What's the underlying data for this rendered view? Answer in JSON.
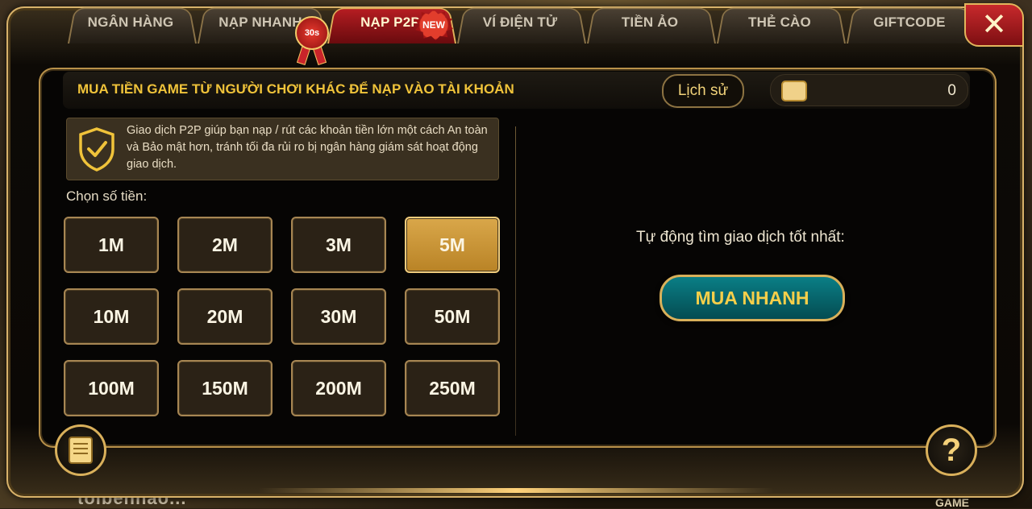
{
  "background": {
    "bottom_text": "toibenhao...",
    "bottom_right_text": "GAME"
  },
  "close_button": {
    "glyph": "✕"
  },
  "tabs": [
    {
      "label": "NGÂN HÀNG",
      "active": false
    },
    {
      "label": "NẠP NHANH",
      "active": false
    },
    {
      "label": "NẠP P2P",
      "active": true
    },
    {
      "label": "VÍ ĐIỆN TỬ",
      "active": false
    },
    {
      "label": "TIỀN ẢO",
      "active": false
    },
    {
      "label": "THẺ CÀO",
      "active": false
    },
    {
      "label": "GIFTCODE",
      "active": false
    }
  ],
  "badges": {
    "nap_nhanh": "30s",
    "nap_p2p": "NEW"
  },
  "header": {
    "title": "MUA TIỀN GAME TỪ NGƯỜI CHƠI KHÁC ĐỂ NẠP VÀO TÀI KHOẢN",
    "history_label": "Lịch sử",
    "wallet_amount": "0"
  },
  "notice": {
    "text": "Giao dịch P2P giúp bạn nạp / rút các khoản tiền lớn một cách An toàn và Bảo mật hơn, tránh tối đa rủi ro bị ngân hàng giám sát hoạt động giao dịch."
  },
  "amounts": {
    "label": "Chọn số tiền:",
    "options": [
      "1M",
      "2M",
      "3M",
      "5M",
      "10M",
      "20M",
      "30M",
      "50M",
      "100M",
      "150M",
      "200M",
      "250M"
    ],
    "selected": "5M"
  },
  "auto_match": {
    "text": "Tự động tìm giao dịch tốt nhất:",
    "button_label": "MUA NHANH"
  },
  "colors": {
    "accent_gold": "#f0c33a",
    "active_tab_red": "#b61d22",
    "selected_amount": "#d9a74a",
    "buy_button_teal": "#0a7e86"
  },
  "icons": {
    "close": "close-icon",
    "wallet": "wallet-icon",
    "shield": "shield-check-icon",
    "document": "document-icon",
    "help": "question-mark-icon"
  }
}
